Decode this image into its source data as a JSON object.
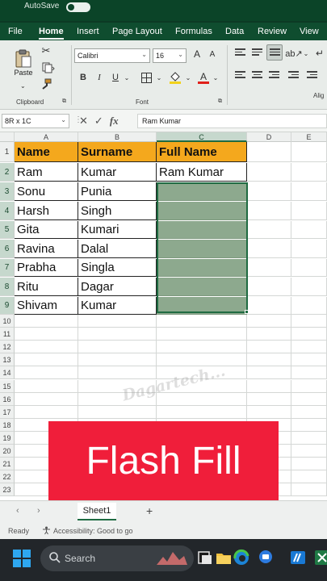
{
  "titlebar": {
    "autosave_text": "AutoSave"
  },
  "menu": {
    "tabs": [
      "File",
      "Home",
      "Insert",
      "Page Layout",
      "Formulas",
      "Data",
      "Review",
      "View"
    ],
    "active": "Home"
  },
  "ribbon": {
    "paste_label": "Paste",
    "clipboard_label": "Clipboard",
    "font_label": "Font",
    "alignment_label": "Alig",
    "font_name": "Calibri",
    "font_size": "16",
    "bold": "B",
    "italic": "I",
    "underline": "U",
    "grow_font": "A",
    "shrink_font": "A"
  },
  "formula_bar": {
    "name_box": "8R x 1C",
    "cancel_glyph": "✕",
    "enter_glyph": "✓",
    "fx_label": "fx",
    "value": "Ram Kumar"
  },
  "grid": {
    "columns": [
      "A",
      "B",
      "C",
      "D",
      "E"
    ],
    "row_numbers": [
      "1",
      "2",
      "3",
      "4",
      "5",
      "6",
      "7",
      "8",
      "9",
      "10",
      "11",
      "12",
      "13",
      "14",
      "15",
      "16",
      "17",
      "18",
      "19",
      "20",
      "21",
      "22",
      "23"
    ],
    "header": [
      "Name",
      "Surname",
      "Full Name"
    ],
    "rows": [
      [
        "Ram",
        "Kumar",
        "Ram Kumar"
      ],
      [
        "Sonu",
        "Punia",
        ""
      ],
      [
        "Harsh",
        "Singh",
        ""
      ],
      [
        "Gita",
        "Kumari",
        ""
      ],
      [
        "Ravina",
        "Dalal",
        ""
      ],
      [
        "Prabha",
        "Singla",
        ""
      ],
      [
        "Ritu",
        "Dagar",
        ""
      ],
      [
        "Shivam",
        "Kumar",
        ""
      ]
    ],
    "watermark": "Dagartech..."
  },
  "banner": {
    "text": "Flash Fill"
  },
  "sheets": {
    "active": "Sheet1",
    "prev_glyph": "‹",
    "next_glyph": "›",
    "add_glyph": "+"
  },
  "status": {
    "ready": "Ready",
    "accessibility": "Accessibility: Good to go"
  },
  "taskbar": {
    "search_placeholder": "Search"
  },
  "colors": {
    "header_fill": "#f4a81d",
    "flash_fill_selection": "#8da98e",
    "banner": "#f01e3a",
    "excel_green": "#1f6b42"
  }
}
